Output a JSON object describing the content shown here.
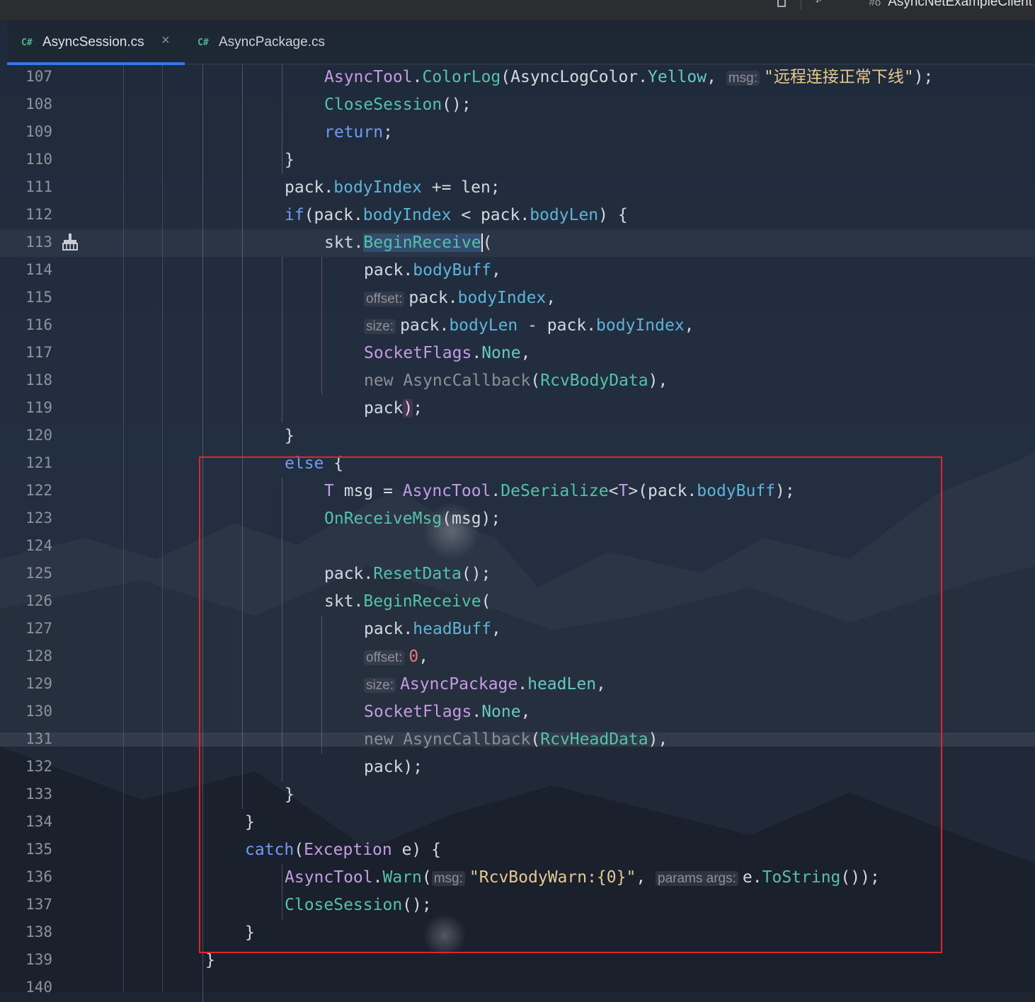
{
  "titlebar": {
    "project_name": "AsyncNetExampleClient",
    "project_icon": "#ô"
  },
  "tabs": [
    {
      "lang": "C#",
      "name": "AsyncSession.cs",
      "active": true,
      "close": "×"
    },
    {
      "lang": "C#",
      "name": "AsyncPackage.cs",
      "active": false
    }
  ],
  "gutter_icon": "broom-icon",
  "colors": {
    "accent": "#3574f0",
    "highlight_box": "#e0262b"
  },
  "lines": [
    {
      "n": "107",
      "tokens": [
        [
          "AsyncTool",
          "cls"
        ],
        [
          ".",
          "plain"
        ],
        [
          "ColorLog",
          "mth"
        ],
        [
          "(",
          "plain"
        ],
        [
          "AsyncLogColor",
          "plain"
        ],
        [
          ".",
          "plain"
        ],
        [
          "Yellow",
          "enumv"
        ],
        [
          ", ",
          "plain"
        ],
        [
          "msg:",
          "hint"
        ],
        [
          "\"远程连接正常下线\"",
          "str"
        ],
        [
          ");",
          "plain"
        ]
      ]
    },
    {
      "n": "108",
      "tokens": [
        [
          "CloseSession",
          "mth"
        ],
        [
          "();",
          "plain"
        ]
      ]
    },
    {
      "n": "109",
      "tokens": [
        [
          "return",
          "kw"
        ],
        [
          ";",
          "plain"
        ]
      ]
    },
    {
      "n": "110",
      "tokens": [
        [
          "}",
          "plain"
        ]
      ]
    },
    {
      "n": "111",
      "tokens": [
        [
          "pack",
          "plain"
        ],
        [
          ".",
          "plain"
        ],
        [
          "bodyIndex",
          "prop"
        ],
        [
          " += len;",
          "plain"
        ]
      ]
    },
    {
      "n": "112",
      "tokens": [
        [
          "if",
          "kw"
        ],
        [
          "(pack.",
          "plain"
        ],
        [
          "bodyIndex",
          "prop"
        ],
        [
          " < pack.",
          "plain"
        ],
        [
          "bodyLen",
          "prop"
        ],
        [
          ") {",
          "plain"
        ]
      ]
    },
    {
      "n": "113",
      "tokens": [
        [
          "skt",
          "plain"
        ],
        [
          ".",
          "plain"
        ],
        [
          "BeginReceive",
          "mth hl caret"
        ],
        [
          "(",
          "plain"
        ]
      ]
    },
    {
      "n": "114",
      "tokens": [
        [
          "pack",
          "plain"
        ],
        [
          ".",
          "plain"
        ],
        [
          "bodyBuff",
          "prop"
        ],
        [
          ",",
          "plain"
        ]
      ]
    },
    {
      "n": "115",
      "tokens": [
        [
          "offset:",
          "hint"
        ],
        [
          "pack",
          "plain"
        ],
        [
          ".",
          "plain"
        ],
        [
          "bodyIndex",
          "prop"
        ],
        [
          ",",
          "plain"
        ]
      ]
    },
    {
      "n": "116",
      "tokens": [
        [
          "size:",
          "hint"
        ],
        [
          "pack",
          "plain"
        ],
        [
          ".",
          "plain"
        ],
        [
          "bodyLen",
          "prop"
        ],
        [
          " - pack.",
          "plain"
        ],
        [
          "bodyIndex",
          "prop"
        ],
        [
          ",",
          "plain"
        ]
      ]
    },
    {
      "n": "117",
      "tokens": [
        [
          "SocketFlags",
          "cls"
        ],
        [
          ".",
          "plain"
        ],
        [
          "None",
          "enumv"
        ],
        [
          ",",
          "plain"
        ]
      ]
    },
    {
      "n": "118",
      "tokens": [
        [
          "new AsyncCallback",
          "dim"
        ],
        [
          "(",
          "plain"
        ],
        [
          "RcvBodyData",
          "mth"
        ],
        [
          "),",
          "plain"
        ]
      ]
    },
    {
      "n": "119",
      "tokens": [
        [
          "pack",
          "plain"
        ],
        [
          ")",
          "pink"
        ],
        [
          ";",
          "plain"
        ]
      ]
    },
    {
      "n": "120",
      "tokens": [
        [
          "}",
          "plain"
        ]
      ]
    },
    {
      "n": "121",
      "tokens": [
        [
          "else",
          "kw"
        ],
        [
          " {",
          "plain"
        ]
      ]
    },
    {
      "n": "122",
      "tokens": [
        [
          "T",
          "cls"
        ],
        [
          " msg = ",
          "plain"
        ],
        [
          "AsyncTool",
          "cls"
        ],
        [
          ".",
          "plain"
        ],
        [
          "DeSerialize",
          "mth"
        ],
        [
          "<",
          "plain"
        ],
        [
          "T",
          "cls"
        ],
        [
          ">(pack.",
          "plain"
        ],
        [
          "bodyBuff",
          "prop"
        ],
        [
          ");",
          "plain"
        ]
      ]
    },
    {
      "n": "123",
      "tokens": [
        [
          "OnReceiveMsg",
          "mth"
        ],
        [
          "(msg);",
          "plain"
        ]
      ]
    },
    {
      "n": "124",
      "tokens": []
    },
    {
      "n": "125",
      "tokens": [
        [
          "pack",
          "plain"
        ],
        [
          ".",
          "plain"
        ],
        [
          "ResetData",
          "mth"
        ],
        [
          "();",
          "plain"
        ]
      ]
    },
    {
      "n": "126",
      "tokens": [
        [
          "skt",
          "plain"
        ],
        [
          ".",
          "plain"
        ],
        [
          "BeginReceive",
          "mth"
        ],
        [
          "(",
          "plain"
        ]
      ]
    },
    {
      "n": "127",
      "tokens": [
        [
          "pack",
          "plain"
        ],
        [
          ".",
          "plain"
        ],
        [
          "headBuff",
          "prop"
        ],
        [
          ",",
          "plain"
        ]
      ]
    },
    {
      "n": "128",
      "tokens": [
        [
          "offset:",
          "hint"
        ],
        [
          "0",
          "num"
        ],
        [
          ",",
          "plain"
        ]
      ]
    },
    {
      "n": "129",
      "tokens": [
        [
          "size:",
          "hint"
        ],
        [
          "AsyncPackage",
          "cls"
        ],
        [
          ".",
          "plain"
        ],
        [
          "headLen",
          "enumv"
        ],
        [
          ",",
          "plain"
        ]
      ]
    },
    {
      "n": "130",
      "tokens": [
        [
          "SocketFlags",
          "cls"
        ],
        [
          ".",
          "plain"
        ],
        [
          "None",
          "enumv"
        ],
        [
          ",",
          "plain"
        ]
      ]
    },
    {
      "n": "131",
      "tokens": [
        [
          "new AsyncCallback",
          "dim"
        ],
        [
          "(",
          "plain"
        ],
        [
          "RcvHeadData",
          "mth"
        ],
        [
          "),",
          "plain"
        ]
      ]
    },
    {
      "n": "132",
      "tokens": [
        [
          "pack",
          "plain"
        ],
        [
          ");",
          "plain"
        ]
      ]
    },
    {
      "n": "133",
      "tokens": [
        [
          "}",
          "plain"
        ]
      ]
    },
    {
      "n": "134",
      "tokens": [
        [
          "}",
          "plain"
        ]
      ]
    },
    {
      "n": "135",
      "tokens": [
        [
          "catch",
          "kw"
        ],
        [
          "(",
          "plain"
        ],
        [
          "Exception",
          "cls"
        ],
        [
          " e) {",
          "plain"
        ]
      ]
    },
    {
      "n": "136",
      "tokens": [
        [
          "AsyncTool",
          "cls"
        ],
        [
          ".",
          "plain"
        ],
        [
          "Warn",
          "mth"
        ],
        [
          "(",
          "plain"
        ],
        [
          "msg:",
          "hint"
        ],
        [
          "\"RcvBodyWarn:{0}\"",
          "str"
        ],
        [
          ", ",
          "plain"
        ],
        [
          "params args:",
          "hint"
        ],
        [
          "e",
          "plain"
        ],
        [
          ".",
          "plain"
        ],
        [
          "ToString",
          "mth"
        ],
        [
          "());",
          "plain"
        ]
      ]
    },
    {
      "n": "137",
      "tokens": [
        [
          "CloseSession",
          "mth"
        ],
        [
          "();",
          "plain"
        ]
      ]
    },
    {
      "n": "138",
      "tokens": [
        [
          "}",
          "plain"
        ]
      ]
    },
    {
      "n": "139",
      "tokens": [
        [
          "}",
          "plain"
        ]
      ]
    },
    {
      "n": "140",
      "tokens": []
    }
  ]
}
